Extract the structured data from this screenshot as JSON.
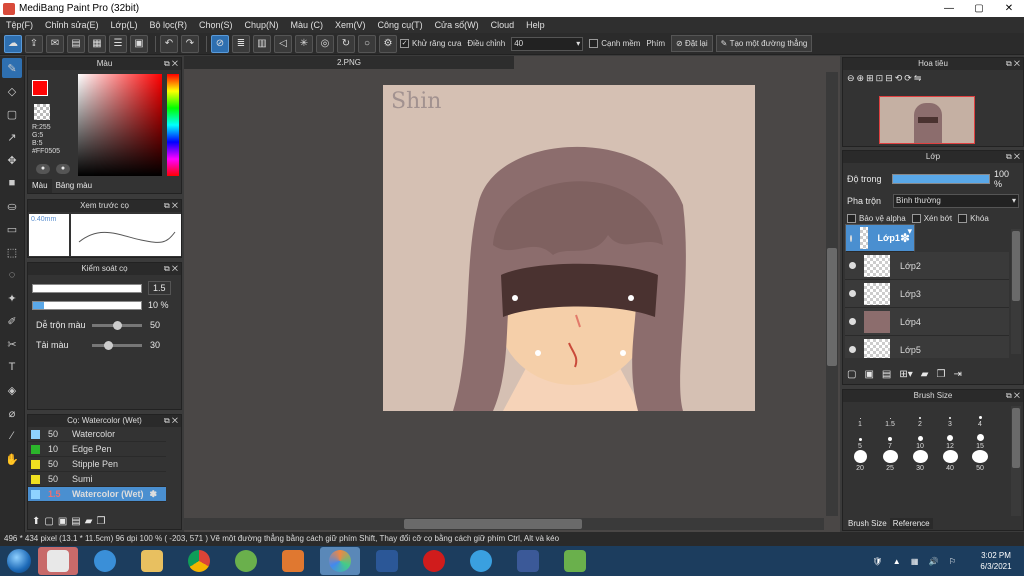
{
  "window": {
    "title": "MediBang Paint Pro (32bit)",
    "min": "—",
    "max": "▢",
    "close": "✕"
  },
  "menu": [
    "Tệp(F)",
    "Chỉnh sửa(E)",
    "Lớp(L)",
    "Bộ lọc(R)",
    "Chọn(S)",
    "Chụp(N)",
    "Màu (C)",
    "Xem(V)",
    "Công cụ(T)",
    "Cửa số(W)",
    "Cloud",
    "Help"
  ],
  "toolbar": {
    "antialias_label": "Khử răng cưa",
    "adjust_label": "Điều chỉnh",
    "adjust_value": "40",
    "edge_label": "Cạnh mềm",
    "phim_label": "Phím",
    "reset_label": "Đặt lại",
    "line_label": "Tạo một đường thẳng"
  },
  "color_panel": {
    "title": "Màu",
    "r": "R:255",
    "g": "G:5",
    "b": "B:5",
    "hex": "#FF0505",
    "tab1": "Màu",
    "tab2": "Bảng màu",
    "color_fg": "#ff0505"
  },
  "preview_panel": {
    "title": "Xem trước cọ",
    "size": "0.40mm"
  },
  "brush_control": {
    "title": "Kiểm soát cọ",
    "size_value": "1.5",
    "opacity_value": "10 %",
    "opacity_fraction": 0.1,
    "mix_label": "Dễ trộn màu",
    "mix_value": "50",
    "mix_fraction": 0.5,
    "flow_label": "Tải màu",
    "flow_value": "30",
    "flow_fraction": 0.3
  },
  "brush_list": {
    "title": "Cọ: Watercolor (Wet)",
    "items": [
      {
        "size": "50",
        "name": "Watercolor",
        "color": "#8fd3ff"
      },
      {
        "size": "10",
        "name": "Edge Pen",
        "color": "#2bb52b"
      },
      {
        "size": "50",
        "name": "Stipple Pen",
        "color": "#f0e020"
      },
      {
        "size": "50",
        "name": "Sumi",
        "color": "#f0e020"
      },
      {
        "size": "1.5",
        "name": "Watercolor (Wet)",
        "color": "#8fd3ff"
      }
    ]
  },
  "document": {
    "tab": "2.PNG",
    "signature": "Shin"
  },
  "navigator": {
    "title": "Hoa tiêu"
  },
  "layers": {
    "title": "Lớp",
    "opacity_label": "Độ trong",
    "opacity_value": "100 %",
    "blend_label": "Pha trộn",
    "blend_value": "Bình thường",
    "protect_alpha": "Bảo vệ alpha",
    "clip": "Xén bớt",
    "lock": "Khóa",
    "items": [
      "Lớp1",
      "Lớp2",
      "Lớp3",
      "Lớp4",
      "Lớp5"
    ]
  },
  "brush_size": {
    "title": "Brush Size",
    "sizes": [
      "1",
      "1.5",
      "2",
      "3",
      "4",
      "5",
      "7",
      "10",
      "12",
      "15",
      "20",
      "25",
      "30",
      "40",
      "50"
    ],
    "tab1": "Brush Size",
    "tab2": "Reference"
  },
  "status": "496 * 434 pixel   (13.1 * 11.5cm)   96 dpi   100 %   ( -203, 571 )   Vẽ một đường thẳng bằng cách giữ phím Shift, Thay đổi cỡ cọ bằng cách giữ phím Ctrl, Alt và kéo",
  "clock": {
    "time": "3:02 PM",
    "date": "6/3/2021"
  }
}
